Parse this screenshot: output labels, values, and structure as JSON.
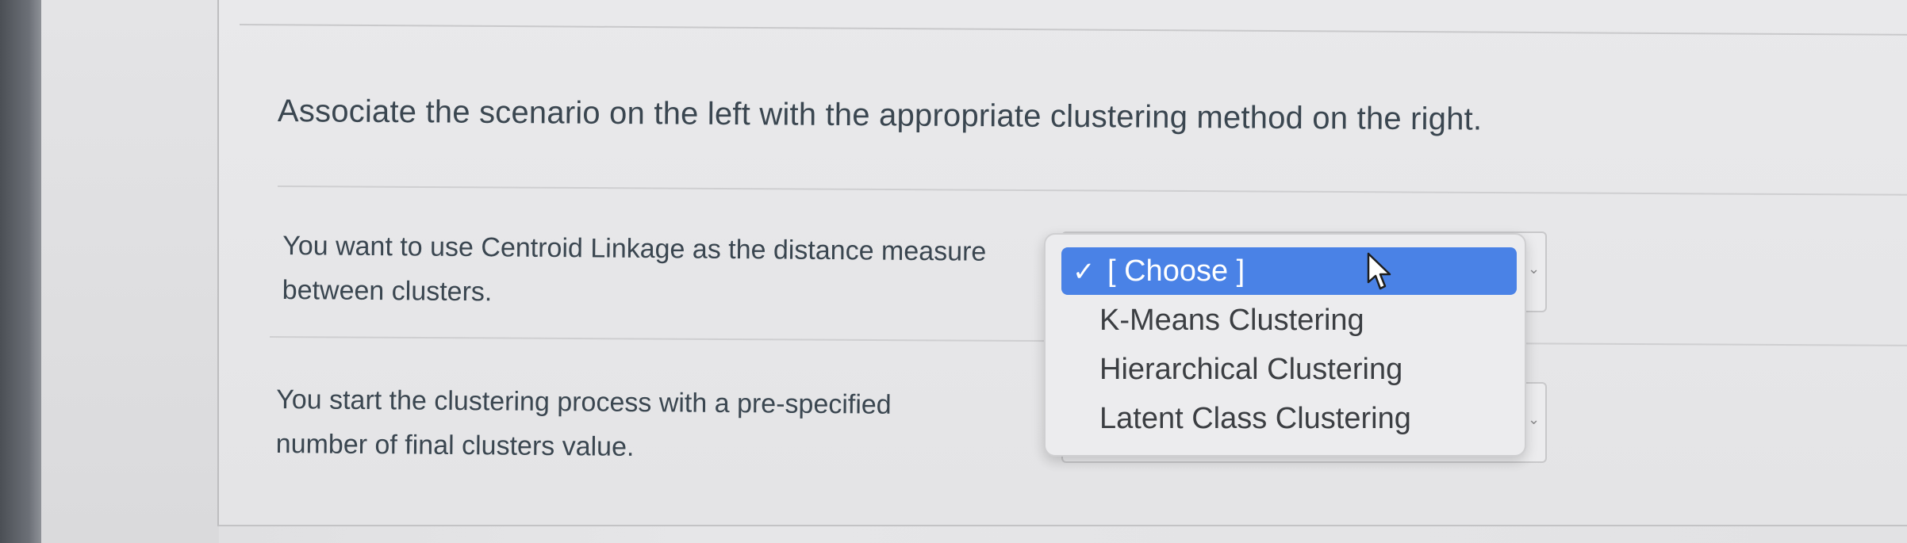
{
  "question": {
    "prompt": "Associate the scenario on the left with the appropriate clustering method on the right."
  },
  "matches": [
    {
      "scenario": "You want to use Centroid Linkage as the distance measure between clusters.",
      "selected": "[ Choose ]"
    },
    {
      "scenario": "You start the clustering process with a pre-specified number of final clusters value.",
      "selected": "[ Choose ]"
    }
  ],
  "dropdown": {
    "options": [
      "[ Choose ]",
      "K-Means Clustering",
      "Hierarchical Clustering",
      "Latent Class Clustering"
    ],
    "checked_index": 0,
    "checkmark": "✓"
  },
  "colors": {
    "highlight": "#4a82e6",
    "text": "#3a4650",
    "background": "#e6e6e8"
  },
  "icons": {
    "pointer": "mouse-pointer-icon",
    "select_arrow": "chevron-down-icon"
  }
}
